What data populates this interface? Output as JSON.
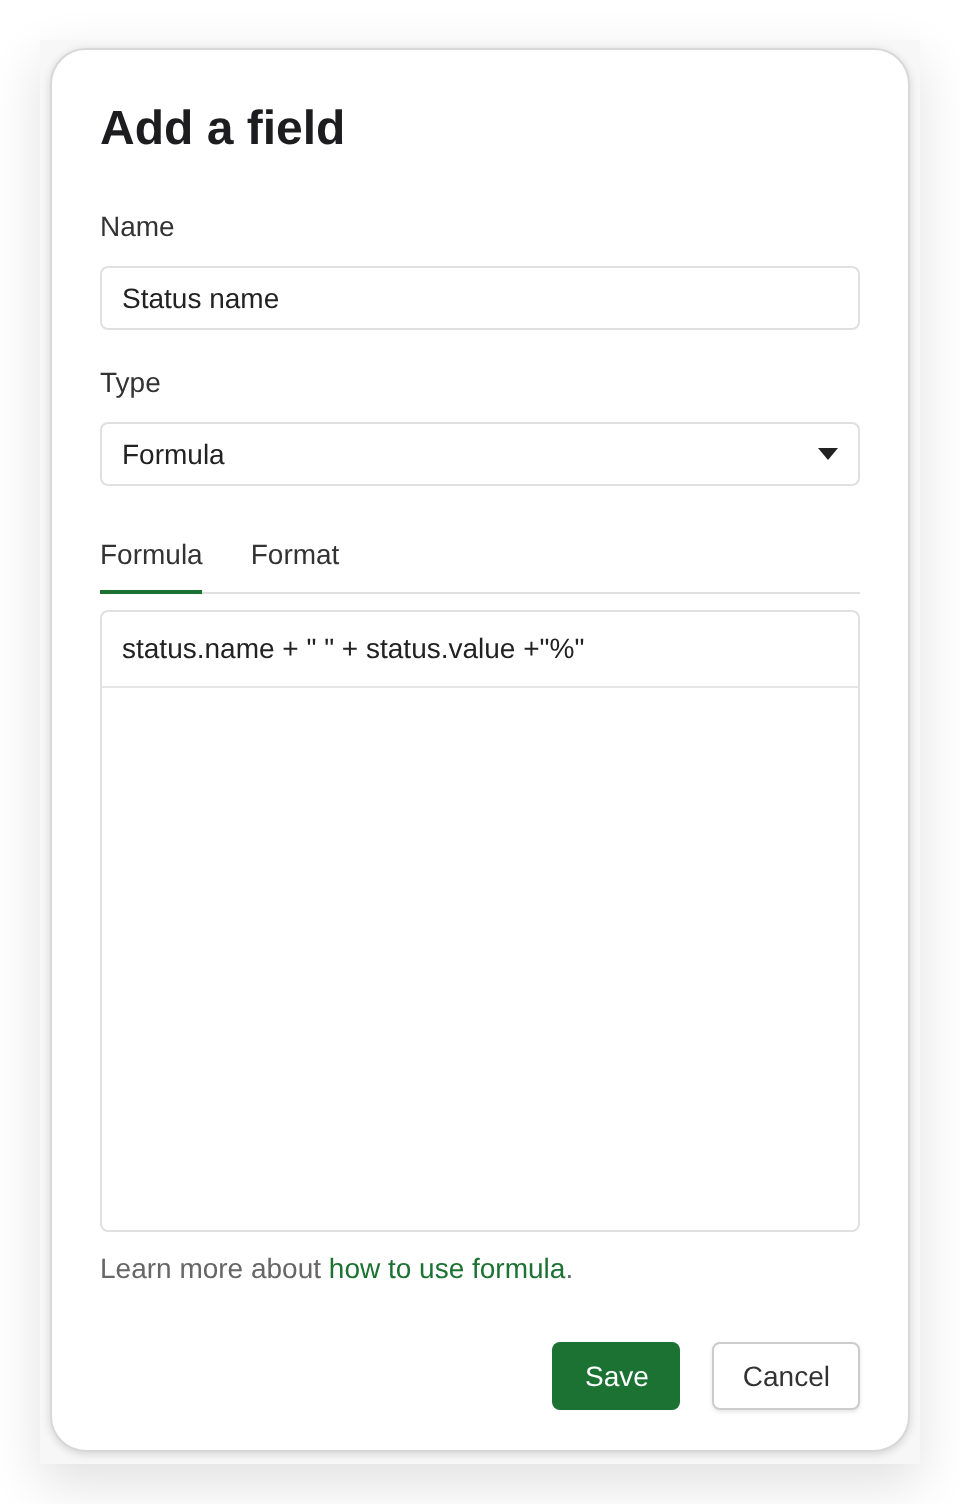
{
  "dialog": {
    "title": "Add a field"
  },
  "name_field": {
    "label": "Name",
    "value": "Status name"
  },
  "type_field": {
    "label": "Type",
    "value": "Formula"
  },
  "tabs": [
    {
      "label": "Formula",
      "selected": true
    },
    {
      "label": "Format",
      "selected": false
    }
  ],
  "formula_editor": {
    "lines": [
      "status.name + \" \" + status.value +\"%\""
    ]
  },
  "help": {
    "before": "Learn more about ",
    "link": "how to use formula",
    "after": "."
  },
  "buttons": [
    {
      "label": "Save",
      "kind": "primary"
    },
    {
      "label": "Cancel",
      "kind": "secondary"
    }
  ]
}
